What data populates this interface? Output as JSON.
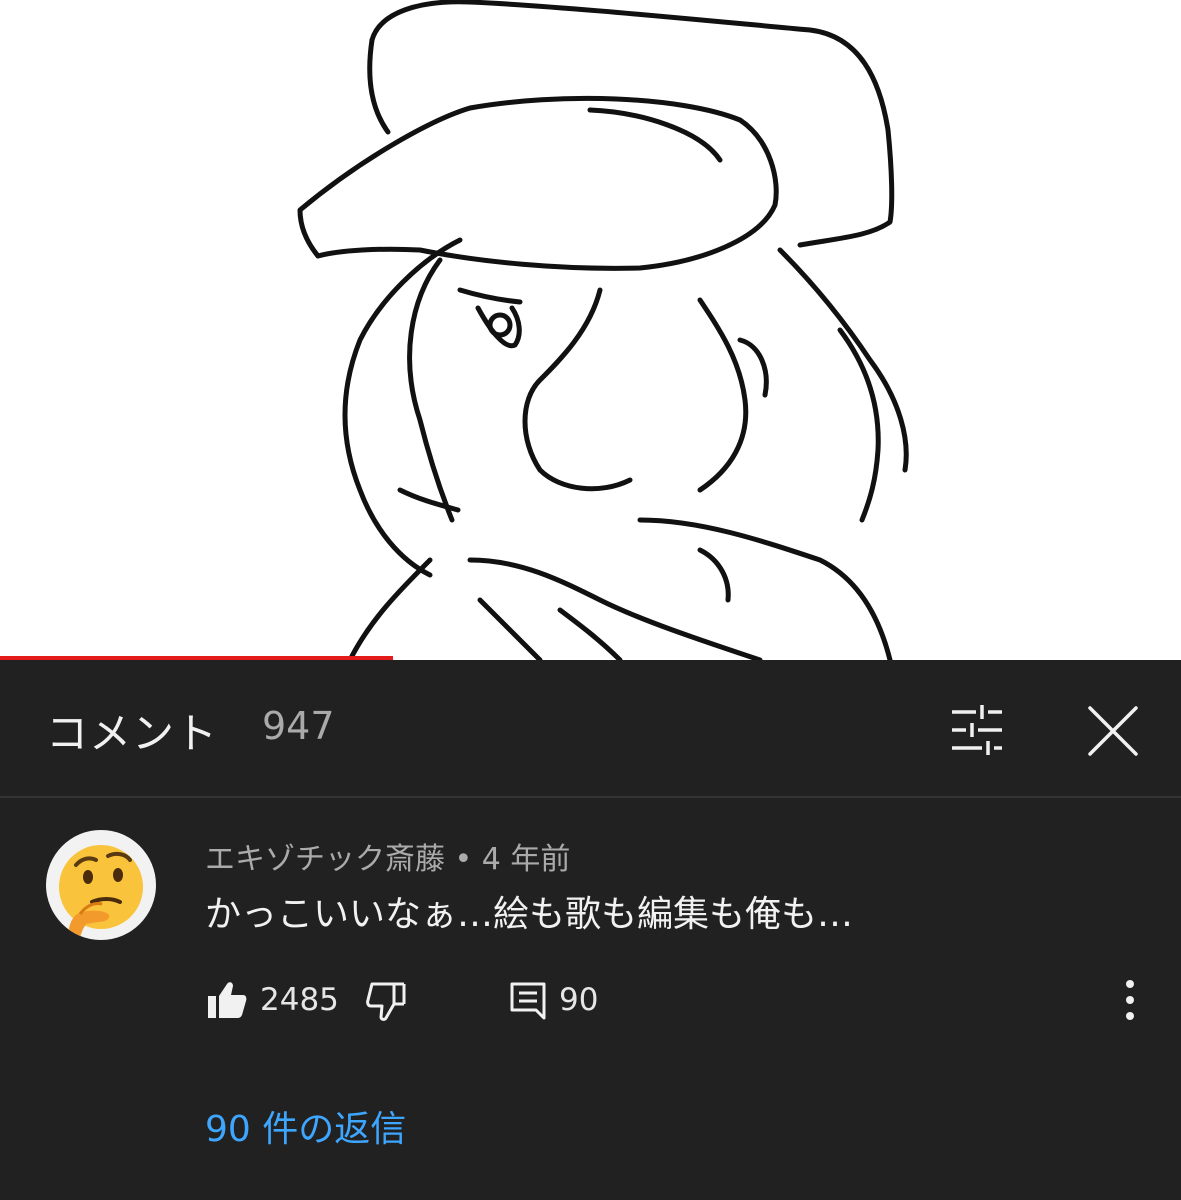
{
  "video": {
    "progress_fraction": 0.333,
    "progress_color": "#e31b1b"
  },
  "comments_header": {
    "title": "コメント",
    "count": "947",
    "filter_icon": "tune-icon",
    "close_icon": "close-icon"
  },
  "comment": {
    "author": "エキゾチック斎藤",
    "separator": " • ",
    "age": "4 年前",
    "text": "かっこいいなぁ…絵も歌も編集も俺も…",
    "avatar_icon": "thinking-face-emoji",
    "like_count": "2485",
    "reply_count": "90",
    "replies_link": "90 件の返信",
    "link_color": "#3ea6ff"
  }
}
